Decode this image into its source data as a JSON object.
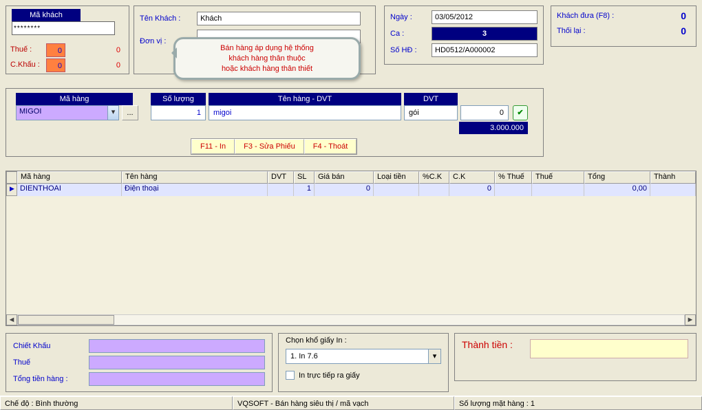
{
  "topLeft": {
    "hdr": "Mã khách",
    "value": "********",
    "rows": [
      {
        "label": "Thuế :",
        "orange": "0",
        "val": "0"
      },
      {
        "label": "C.Khấu :",
        "orange": "0",
        "val": "0"
      }
    ]
  },
  "topMid": {
    "tenKhachLbl": "Tên Khách :",
    "tenKhach": "Khách",
    "donViLbl": "Đơn vị :",
    "donVi": ""
  },
  "tooltip": {
    "l1": "Bán hàng áp dụng hệ thống",
    "l2": "khách hàng thân thuộc",
    "l3": "hoặc khách hàng thân thiết"
  },
  "topRight1": {
    "ngayLbl": "Ngày :",
    "ngay": "03/05/2012",
    "caLbl": "Ca :",
    "ca": "3",
    "soHdLbl": "Số HĐ :",
    "soHd": "HD0512/A000002"
  },
  "topRight2": {
    "khachDuaLbl": "Khách đưa (F8) :",
    "khachDua": "0",
    "thoiLaiLbl": "Thối lại :",
    "thoiLai": "0"
  },
  "item": {
    "maHangHdr": "Mã hàng",
    "maHang": "MIGOI",
    "browse": "...",
    "soLuongHdr": "Số lượng",
    "soLuong": "1",
    "tenHangHdr": "Tên hàng - DVT",
    "tenHang": "migoi",
    "dvtHdr": "DVT",
    "dvt": "gói",
    "gia": "0",
    "price": "3.000.000",
    "f11": "F11 - In",
    "f3": "F3 - Sửa Phiếu",
    "f4": "F4 - Thoát"
  },
  "gridHead": [
    "Mã hàng",
    "Tên hàng",
    "DVT",
    "SL",
    "Giá bán",
    "Loại tiền",
    "%C.K",
    "C.K",
    "% Thuế",
    "Thuế",
    "Tổng",
    "Thành"
  ],
  "gridRow": {
    "ma": "DIENTHOAI",
    "ten": "Điện thoại",
    "dvt": "",
    "sl": "1",
    "gia": "0",
    "loai": "",
    "pck": "",
    "ck": "0",
    "pthue": "",
    "thue": "",
    "tong": "0,00",
    "thanh": ""
  },
  "botLeft": {
    "chietKhau": "Chiết Khấu",
    "thue": "Thuế",
    "tongTien": "Tổng tiền hàng :"
  },
  "botMid": {
    "chon": "Chọn khổ giấy In :",
    "sel": "1. In 7.6",
    "chk": "In trực tiếp ra giấy"
  },
  "botRight": {
    "lbl": "Thành tiền :",
    "val": ""
  },
  "status": {
    "c1": "Chế độ : Bình thường",
    "c2": "VQSOFT - Bán hàng siêu thị / mã vạch",
    "c3": "Số lượng mặt hàng : 1"
  }
}
